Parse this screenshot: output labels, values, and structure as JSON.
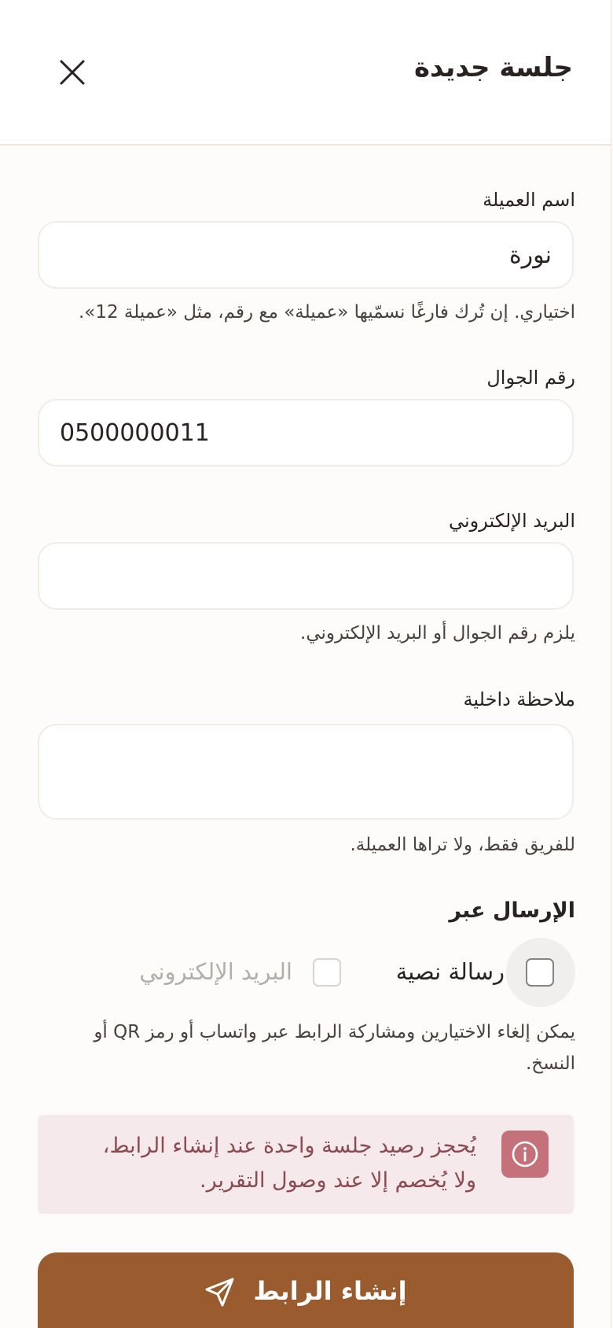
{
  "header": {
    "title": "جلسة جديدة",
    "close_icon": "close-icon"
  },
  "form": {
    "client_name": {
      "label": "اسم العميلة",
      "value": "نورة",
      "hint": "اختياري. إن تُرك فارغًا نسمّيها «عميلة» مع رقم، مثل «عميلة 12»."
    },
    "phone": {
      "label": "رقم الجوال",
      "value": "0500000011"
    },
    "email": {
      "label": "البريد الإلكتروني",
      "value": "",
      "hint": "يلزم رقم الجوال أو البريد الإلكتروني."
    },
    "note": {
      "label": "ملاحظة داخلية",
      "value": "",
      "hint": "للفريق فقط، ولا تراها العميلة."
    }
  },
  "send_via": {
    "title": "الإرسال عبر",
    "options": [
      {
        "label": "رسالة نصية",
        "checked": false,
        "disabled": false
      },
      {
        "label": "البريد الإلكتروني",
        "checked": false,
        "disabled": true
      }
    ],
    "hint_line1": "يمكن إلغاء الاختيارين ومشاركة الرابط عبر واتساب أو رمز QR أو",
    "hint_line2": "النسخ."
  },
  "info": {
    "icon": "info-icon",
    "line1": "يُحجز رصيد جلسة واحدة عند إنشاء الرابط،",
    "line2": "ولا يُخصم إلا عند وصول التقرير."
  },
  "action": {
    "label": "إنشاء الرابط",
    "icon": "send-icon"
  },
  "colors": {
    "accent": "#9a5c2e",
    "info_bg": "#f5e9eb",
    "info_icon": "#c4717b",
    "info_text": "#8a4a50"
  }
}
